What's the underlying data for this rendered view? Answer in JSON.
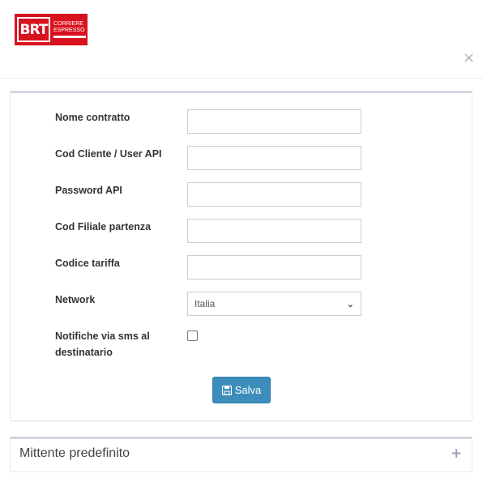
{
  "header": {
    "logo_letters": "BRT",
    "logo_line1": "CORRIERE",
    "logo_line2": "ESPRESSO",
    "close_glyph": "×"
  },
  "form": {
    "fields": [
      {
        "label": "Nome contratto",
        "value": ""
      },
      {
        "label": "Cod Cliente / User API",
        "value": ""
      },
      {
        "label": "Password API",
        "value": ""
      },
      {
        "label": "Cod Filiale partenza",
        "value": ""
      },
      {
        "label": "Codice tariffa",
        "value": ""
      }
    ],
    "network": {
      "label": "Network",
      "selected": "Italia"
    },
    "sms": {
      "label": "Notifiche via sms al destinatario",
      "checked": false
    },
    "save_label": "Salva"
  },
  "sender_panel": {
    "title": "Mittente predefinito",
    "toggle_glyph": "+"
  },
  "colors": {
    "brand_red": "#d9121f",
    "primary_button": "#3c8dbc"
  }
}
